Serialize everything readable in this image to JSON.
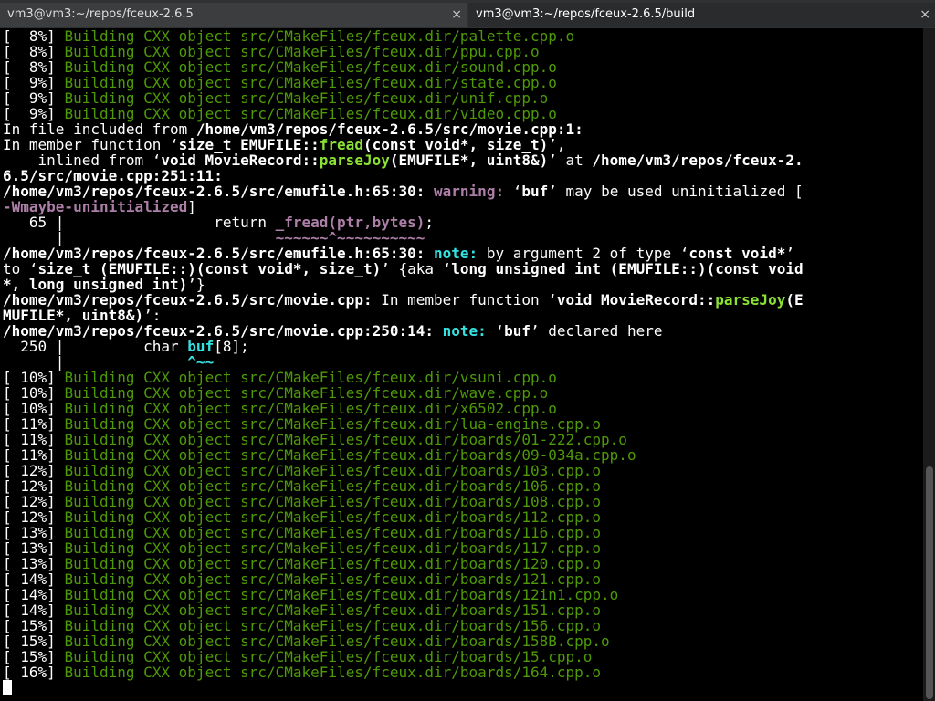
{
  "tabs": [
    {
      "title": "vm3@vm3:~/repos/fceux-2.6.5",
      "close": "×"
    },
    {
      "title": "vm3@vm3:~/repos/fceux-2.6.5/build",
      "close": "×"
    }
  ],
  "colors": {
    "normal": "#ffffff",
    "build": "#4e9a06",
    "warning": "#ad7fa8",
    "note": "#34e2e2",
    "func": "#8ae234"
  },
  "lines": [
    [
      {
        "t": "[  8%] ",
        "c": "w"
      },
      {
        "t": "Building CXX object src/CMakeFiles/fceux.dir/palette.cpp.o",
        "c": "g"
      }
    ],
    [
      {
        "t": "[  8%] ",
        "c": "w"
      },
      {
        "t": "Building CXX object src/CMakeFiles/fceux.dir/ppu.cpp.o",
        "c": "g"
      }
    ],
    [
      {
        "t": "[  8%] ",
        "c": "w"
      },
      {
        "t": "Building CXX object src/CMakeFiles/fceux.dir/sound.cpp.o",
        "c": "g"
      }
    ],
    [
      {
        "t": "[  9%] ",
        "c": "w"
      },
      {
        "t": "Building CXX object src/CMakeFiles/fceux.dir/state.cpp.o",
        "c": "g"
      }
    ],
    [
      {
        "t": "[  9%] ",
        "c": "w"
      },
      {
        "t": "Building CXX object src/CMakeFiles/fceux.dir/unif.cpp.o",
        "c": "g"
      }
    ],
    [
      {
        "t": "[  9%] ",
        "c": "w"
      },
      {
        "t": "Building CXX object src/CMakeFiles/fceux.dir/video.cpp.o",
        "c": "g"
      }
    ],
    [
      {
        "t": "In file included from ",
        "c": "w"
      },
      {
        "t": "/home/vm3/repos/fceux-2.6.5/src/movie.cpp:1:",
        "c": "w b"
      }
    ],
    [
      {
        "t": "In member function ‘",
        "c": "w"
      },
      {
        "t": "size_t EMUFILE::",
        "c": "w b"
      },
      {
        "t": "fread",
        "c": "y b"
      },
      {
        "t": "(const void*, size_t)",
        "c": "w b"
      },
      {
        "t": "’,",
        "c": "w"
      }
    ],
    [
      {
        "t": "    inlined from ‘",
        "c": "w"
      },
      {
        "t": "void MovieRecord::",
        "c": "w b"
      },
      {
        "t": "parseJoy",
        "c": "y b"
      },
      {
        "t": "(EMUFILE*, uint8&)",
        "c": "w b"
      },
      {
        "t": "’ at ",
        "c": "w"
      },
      {
        "t": "/home/vm3/repos/fceux-2.",
        "c": "w b"
      }
    ],
    [
      {
        "t": "6.5/src/movie.cpp:251:11:",
        "c": "w b"
      }
    ],
    [
      {
        "t": "/home/vm3/repos/fceux-2.6.5/src/emufile.h:65:30: ",
        "c": "w b"
      },
      {
        "t": "warning: ",
        "c": "m b"
      },
      {
        "t": "‘",
        "c": "w"
      },
      {
        "t": "buf",
        "c": "w b"
      },
      {
        "t": "’ may be used uninitialized [",
        "c": "w"
      }
    ],
    [
      {
        "t": "-Wmaybe-uninitialized",
        "c": "m b"
      },
      {
        "t": "]",
        "c": "w"
      }
    ],
    [
      {
        "t": "   65 | ",
        "c": "w"
      },
      {
        "t": "                return ",
        "c": "w"
      },
      {
        "t": "_fread(ptr,bytes)",
        "c": "m b"
      },
      {
        "t": ";",
        "c": "w"
      }
    ],
    [
      {
        "t": "      | ",
        "c": "w"
      },
      {
        "t": "                       ",
        "c": "w"
      },
      {
        "t": "~~~~~~^~~~~~~~~~~",
        "c": "m b"
      }
    ],
    [
      {
        "t": "/home/vm3/repos/fceux-2.6.5/src/emufile.h:65:30: ",
        "c": "w b"
      },
      {
        "t": "note: ",
        "c": "c b"
      },
      {
        "t": "by argument 2 of type ‘",
        "c": "w"
      },
      {
        "t": "const void*",
        "c": "w b"
      },
      {
        "t": "’",
        "c": "w"
      }
    ],
    [
      {
        "t": "to ‘",
        "c": "w"
      },
      {
        "t": "size_t (EMUFILE::)(const void*, size_t)",
        "c": "w b"
      },
      {
        "t": "’ {aka ‘",
        "c": "w"
      },
      {
        "t": "long unsigned int (EMUFILE::)(const void",
        "c": "w b"
      }
    ],
    [
      {
        "t": "*, long unsigned int)",
        "c": "w b"
      },
      {
        "t": "’}",
        "c": "w"
      }
    ],
    [
      {
        "t": "/home/vm3/repos/fceux-2.6.5/src/movie.cpp:",
        "c": "w b"
      },
      {
        "t": " In member function ‘",
        "c": "w"
      },
      {
        "t": "void MovieRecord::",
        "c": "w b"
      },
      {
        "t": "parseJoy",
        "c": "y b"
      },
      {
        "t": "(E",
        "c": "w b"
      }
    ],
    [
      {
        "t": "MUFILE*, uint8&)",
        "c": "w b"
      },
      {
        "t": "’:",
        "c": "w"
      }
    ],
    [
      {
        "t": "/home/vm3/repos/fceux-2.6.5/src/movie.cpp:250:14: ",
        "c": "w b"
      },
      {
        "t": "note: ",
        "c": "c b"
      },
      {
        "t": "‘",
        "c": "w"
      },
      {
        "t": "buf",
        "c": "w b"
      },
      {
        "t": "’ declared here",
        "c": "w"
      }
    ],
    [
      {
        "t": "  250 | ",
        "c": "w"
      },
      {
        "t": "        char ",
        "c": "w"
      },
      {
        "t": "buf",
        "c": "c b"
      },
      {
        "t": "[8];",
        "c": "w"
      }
    ],
    [
      {
        "t": "      | ",
        "c": "w"
      },
      {
        "t": "             ",
        "c": "w"
      },
      {
        "t": "^~~",
        "c": "c b"
      }
    ],
    [
      {
        "t": "[ 10%] ",
        "c": "w"
      },
      {
        "t": "Building CXX object src/CMakeFiles/fceux.dir/vsuni.cpp.o",
        "c": "g"
      }
    ],
    [
      {
        "t": "[ 10%] ",
        "c": "w"
      },
      {
        "t": "Building CXX object src/CMakeFiles/fceux.dir/wave.cpp.o",
        "c": "g"
      }
    ],
    [
      {
        "t": "[ 10%] ",
        "c": "w"
      },
      {
        "t": "Building CXX object src/CMakeFiles/fceux.dir/x6502.cpp.o",
        "c": "g"
      }
    ],
    [
      {
        "t": "[ 11%] ",
        "c": "w"
      },
      {
        "t": "Building CXX object src/CMakeFiles/fceux.dir/lua-engine.cpp.o",
        "c": "g"
      }
    ],
    [
      {
        "t": "[ 11%] ",
        "c": "w"
      },
      {
        "t": "Building CXX object src/CMakeFiles/fceux.dir/boards/01-222.cpp.o",
        "c": "g"
      }
    ],
    [
      {
        "t": "[ 11%] ",
        "c": "w"
      },
      {
        "t": "Building CXX object src/CMakeFiles/fceux.dir/boards/09-034a.cpp.o",
        "c": "g"
      }
    ],
    [
      {
        "t": "[ 12%] ",
        "c": "w"
      },
      {
        "t": "Building CXX object src/CMakeFiles/fceux.dir/boards/103.cpp.o",
        "c": "g"
      }
    ],
    [
      {
        "t": "[ 12%] ",
        "c": "w"
      },
      {
        "t": "Building CXX object src/CMakeFiles/fceux.dir/boards/106.cpp.o",
        "c": "g"
      }
    ],
    [
      {
        "t": "[ 12%] ",
        "c": "w"
      },
      {
        "t": "Building CXX object src/CMakeFiles/fceux.dir/boards/108.cpp.o",
        "c": "g"
      }
    ],
    [
      {
        "t": "[ 12%] ",
        "c": "w"
      },
      {
        "t": "Building CXX object src/CMakeFiles/fceux.dir/boards/112.cpp.o",
        "c": "g"
      }
    ],
    [
      {
        "t": "[ 13%] ",
        "c": "w"
      },
      {
        "t": "Building CXX object src/CMakeFiles/fceux.dir/boards/116.cpp.o",
        "c": "g"
      }
    ],
    [
      {
        "t": "[ 13%] ",
        "c": "w"
      },
      {
        "t": "Building CXX object src/CMakeFiles/fceux.dir/boards/117.cpp.o",
        "c": "g"
      }
    ],
    [
      {
        "t": "[ 13%] ",
        "c": "w"
      },
      {
        "t": "Building CXX object src/CMakeFiles/fceux.dir/boards/120.cpp.o",
        "c": "g"
      }
    ],
    [
      {
        "t": "[ 14%] ",
        "c": "w"
      },
      {
        "t": "Building CXX object src/CMakeFiles/fceux.dir/boards/121.cpp.o",
        "c": "g"
      }
    ],
    [
      {
        "t": "[ 14%] ",
        "c": "w"
      },
      {
        "t": "Building CXX object src/CMakeFiles/fceux.dir/boards/12in1.cpp.o",
        "c": "g"
      }
    ],
    [
      {
        "t": "[ 14%] ",
        "c": "w"
      },
      {
        "t": "Building CXX object src/CMakeFiles/fceux.dir/boards/151.cpp.o",
        "c": "g"
      }
    ],
    [
      {
        "t": "[ 15%] ",
        "c": "w"
      },
      {
        "t": "Building CXX object src/CMakeFiles/fceux.dir/boards/156.cpp.o",
        "c": "g"
      }
    ],
    [
      {
        "t": "[ 15%] ",
        "c": "w"
      },
      {
        "t": "Building CXX object src/CMakeFiles/fceux.dir/boards/158B.cpp.o",
        "c": "g"
      }
    ],
    [
      {
        "t": "[ 15%] ",
        "c": "w"
      },
      {
        "t": "Building CXX object src/CMakeFiles/fceux.dir/boards/15.cpp.o",
        "c": "g"
      }
    ],
    [
      {
        "t": "[ 16%] ",
        "c": "w"
      },
      {
        "t": "Building CXX object src/CMakeFiles/fceux.dir/boards/164.cpp.o",
        "c": "g"
      }
    ]
  ]
}
